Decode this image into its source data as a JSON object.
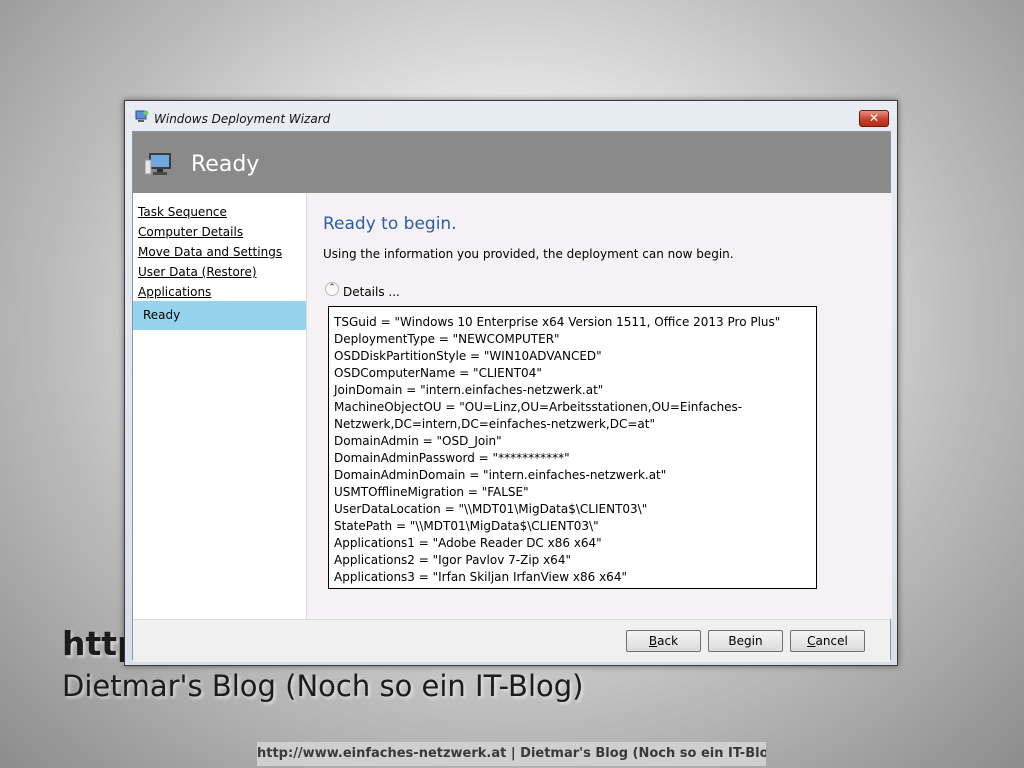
{
  "background": {
    "line1": "http",
    "line2": "Dietmar's Blog (Noch so ein IT-Blog)",
    "footer": "http://www.einfaches-netzwerk.at | Dietmar's Blog (Noch so ein IT-Blog)"
  },
  "window": {
    "title": "Windows Deployment Wizard",
    "close_label": "✕",
    "header_title": "Ready"
  },
  "sidebar": {
    "items": [
      {
        "label": "Task Sequence"
      },
      {
        "label": "Computer Details"
      },
      {
        "label": "Move Data and Settings"
      },
      {
        "label": "User Data (Restore)"
      },
      {
        "label": "Applications"
      }
    ],
    "active": "Ready"
  },
  "main": {
    "heading": "Ready to begin.",
    "description": "Using the information you provided, the deployment can now begin.",
    "details_toggle": "⌃",
    "details_label": "Details ...",
    "details_lines": [
      "TSGuid = \"Windows 10 Enterprise x64 Version 1511, Office 2013 Pro Plus\"",
      "DeploymentType = \"NEWCOMPUTER\"",
      "OSDDiskPartitionStyle = \"WIN10ADVANCED\"",
      "OSDComputerName = \"CLIENT04\"",
      "JoinDomain = \"intern.einfaches-netzwerk.at\"",
      "MachineObjectOU = \"OU=Linz,OU=Arbeitsstationen,OU=Einfaches-",
      "Netzwerk,DC=intern,DC=einfaches-netzwerk,DC=at\"",
      "DomainAdmin = \"OSD_Join\"",
      "DomainAdminPassword = \"***********\"",
      "DomainAdminDomain = \"intern.einfaches-netzwerk.at\"",
      "USMTOfflineMigration = \"FALSE\"",
      "UserDataLocation = \"\\\\MDT01\\MigData$\\CLIENT03\\\"",
      "StatePath = \"\\\\MDT01\\MigData$\\CLIENT03\\\"",
      "Applications1 = \"Adobe Reader DC x86 x64\"",
      "Applications2 = \"Igor Pavlov 7-Zip x64\"",
      "Applications3 = \"Irfan Skiljan IrfanView x86 x64\""
    ]
  },
  "buttons": {
    "back": {
      "mnemonic": "B",
      "rest": "ack"
    },
    "begin": {
      "label": "Begin"
    },
    "cancel": {
      "mnemonic": "C",
      "rest": "ancel"
    }
  }
}
